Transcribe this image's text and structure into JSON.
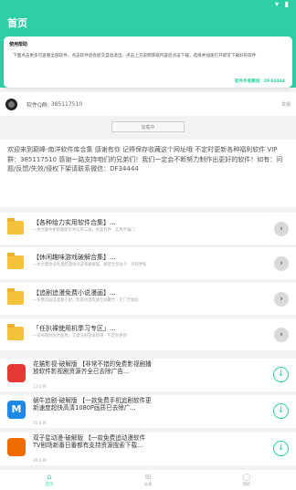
{
  "status_bar": {
    "icons": "▾ ▮"
  },
  "app_bar": {
    "title": "首页"
  },
  "notice": {
    "title": "使用帮助",
    "text": "下面点击更多可查看全部软件，点击软件后会提交自动退出，点击上方说明获取内容后点击下载，选择并加速打开即可下载好的软件",
    "author": "软件作者微信：DF34444"
  },
  "profile": {
    "qq_label": "软件Q群:",
    "qq_value": "385117510",
    "right_text": "举报"
  },
  "action_button": {
    "label": "加载中"
  },
  "intro": {
    "text": "欢迎来到巅峰-南洋软件库合集 感谢有你 记得保存收藏这个网址哦 不定时更新各种福利软件 VIP群：385117510 感谢一路支持咱们的兄弟们！我们一定会不断努力制作出更好的软件！如有：问题/反馈/失效/侵权下架请联系微信：DF34444"
  },
  "folders": [
    {
      "title": "【各种给力实用软件合集】...",
      "subtitle": "—本合集中更新最新优秀实用工具，各类软件 · 实用不偏门"
    },
    {
      "title": "【休闲趣味游戏破解合集】...",
      "subtitle": "—本合集收录各类经典休闲游戏破解版，解锁全部关卡 · 持续更新"
    },
    {
      "title": "【追剧追漫免费小说漫画】...",
      "subtitle": "—免费追剧追漫看小说，影视动漫资源全网聚合 · 无广告体验"
    },
    {
      "title": "「任扒裸使用机季习专区」...",
      "subtitle": "—去掉限制免费使用，无需注册登录即用 · 不定时更新"
    }
  ],
  "apps": [
    {
      "icon_text": "",
      "icon_color": "#e53935",
      "title": "花猫影视-破解版 【非常不错的免费影视剧播放软件影视剧资源齐全已去除广告...",
      "size": "23.0 M"
    },
    {
      "icon_text": "M",
      "icon_color": "#1e88e5",
      "title": "蜗牛追剧-破解版 【一款免费手机追剧软件更新速度超快高清1080P画质已去除广...",
      "size": "35.8 M"
    },
    {
      "icon_text": "",
      "icon_color": "#ef6c00",
      "title": "双子星动漫-破解版 【一款免费追动漫软件TV剧场新番日番都有支持资源搜索下载...",
      "size": "39.2 M"
    }
  ],
  "nav": {
    "tabs": [
      {
        "icon": "⌂",
        "label": "首页"
      },
      {
        "icon": "⊞",
        "label": "分类"
      },
      {
        "icon": "◯",
        "label": "我的"
      }
    ]
  },
  "colors": {
    "accent": "#2fcfa6",
    "folder": "#f5c23b"
  }
}
